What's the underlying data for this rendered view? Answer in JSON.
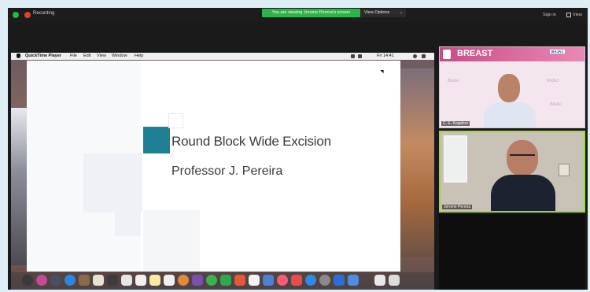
{
  "zoom": {
    "recording_label": "Recording",
    "viewing_banner": "You are viewing Jerome Pereira's screen",
    "view_options_label": "View Options",
    "sign_in_label": "Sign in",
    "view_label": "View"
  },
  "mac": {
    "app_name": "QuickTime Player",
    "menu": [
      "File",
      "Edit",
      "View",
      "Window",
      "Help"
    ],
    "clock": "Fri 14:41"
  },
  "slide": {
    "title": "Round Block Wide Excision",
    "subtitle": "Professor J. Pereira"
  },
  "participants": [
    {
      "name": "C. E. Koppiker",
      "banner": "BREAST",
      "sponsor": "BAJAJ"
    },
    {
      "name": "Jerome Pereira"
    }
  ],
  "colors": {
    "accent_teal": "#1e7f95",
    "zoom_green": "#2fb24a",
    "active_speaker_border": "#9ddc2e"
  }
}
